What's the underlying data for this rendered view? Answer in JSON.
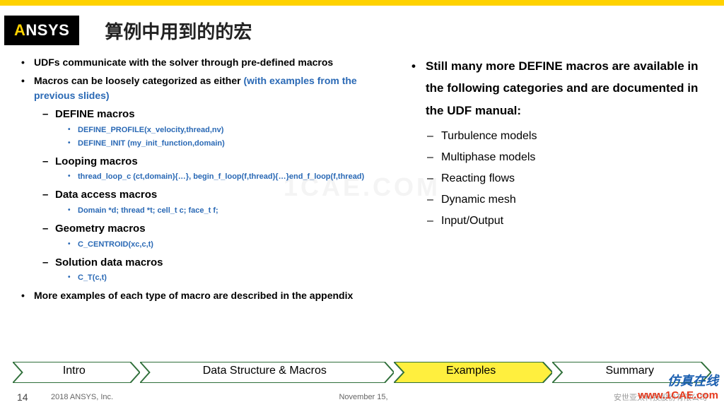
{
  "logo": {
    "part1": "A",
    "part2": "NSYS"
  },
  "title": "算例中用到的的宏",
  "left": {
    "b1": "UDFs communicate with the solver through pre-defined macros",
    "b2a": "Macros can be loosely categorized as either ",
    "b2b": "(with examples from the previous slides)",
    "define": {
      "h": "DEFINE macros",
      "i1": "DEFINE_PROFILE(x_velocity,thread,nv)",
      "i2": "DEFINE_INIT (my_init_function,domain)"
    },
    "loop": {
      "h": "Looping macros",
      "i1": "thread_loop_c (ct,domain){…}, begin_f_loop(f,thread){…}end_f_loop(f,thread)"
    },
    "data": {
      "h": "Data access macros",
      "i1": "Domain *d; thread *t; cell_t c; face_t f;"
    },
    "geom": {
      "h": "Geometry macros",
      "i1": "C_CENTROID(xc,c,t)"
    },
    "sol": {
      "h": "Solution data macros",
      "i1": "C_T(c,t)"
    },
    "b3": "More examples of each type of macro are described in the appendix"
  },
  "right": {
    "top": "Still many more DEFINE macros are available in the following categories  and are documented in the UDF manual:",
    "i1": "Turbulence models",
    "i2": "Multiphase models",
    "i3": "Reacting flows",
    "i4": "Dynamic mesh",
    "i5": "Input/Output"
  },
  "nav": {
    "s1": "Intro",
    "s2": "Data Structure & Macros",
    "s3": "Examples",
    "s4": "Summary"
  },
  "footer": {
    "page": "14",
    "copy": "2018   ANSYS, Inc.",
    "date": "November 15,",
    "company": "安世亚太科技股份有限公司"
  },
  "watermark_center": "1CAE.COM",
  "wmk2": {
    "l1": "仿真在线",
    "l2": "www.1CAE.com"
  }
}
